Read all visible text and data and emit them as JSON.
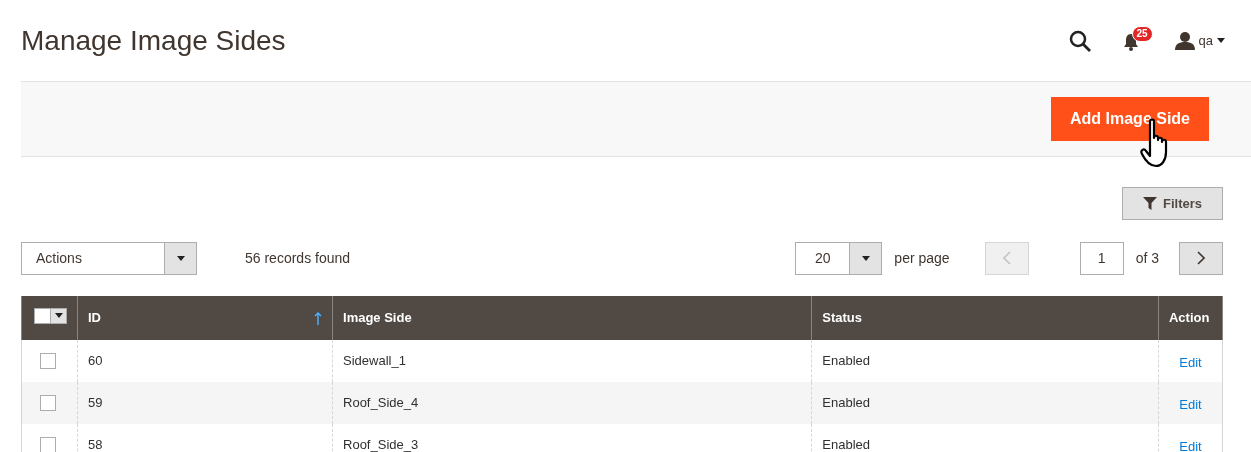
{
  "header": {
    "title": "Manage Image Sides",
    "notifications": {
      "count": "25"
    },
    "user": {
      "name": "qa"
    }
  },
  "page_actions": {
    "add_button": "Add Image Side"
  },
  "filters_button": "Filters",
  "toolbar": {
    "actions": {
      "value": "Actions"
    },
    "records": "56 records found",
    "per_page": {
      "value": "20",
      "label": "per page"
    },
    "pager": {
      "page": "1",
      "of": "of 3",
      "prev": {
        "disabled": true
      },
      "next": {
        "disabled": false
      }
    }
  },
  "table": {
    "select_all": {
      "checked": false
    },
    "columns": [
      {
        "label": "ID",
        "sorted": true
      },
      {
        "label": "Image Side",
        "sorted": false
      },
      {
        "label": "Status",
        "sorted": false
      },
      {
        "label": "Action",
        "sorted": false
      }
    ],
    "rows": [
      {
        "checked": false,
        "id": "60",
        "image_side": "Sidewall_1",
        "status": "Enabled",
        "action": "Edit"
      },
      {
        "checked": false,
        "id": "59",
        "image_side": "Roof_Side_4",
        "status": "Enabled",
        "action": "Edit"
      },
      {
        "checked": false,
        "id": "58",
        "image_side": "Roof_Side_3",
        "status": "Enabled",
        "action": "Edit"
      }
    ]
  }
}
